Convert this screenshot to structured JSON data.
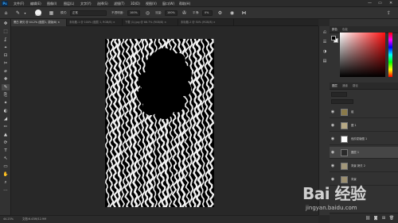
{
  "app": {
    "logo": "Ps"
  },
  "menu": [
    "文件(F)",
    "编辑(E)",
    "图像(I)",
    "图层(L)",
    "文字(Y)",
    "选择(S)",
    "滤镜(T)",
    "3D(D)",
    "视图(V)",
    "窗口(W)",
    "帮助(H)"
  ],
  "window_controls": {
    "minimize": "—",
    "restore": "▭",
    "close": "✕"
  },
  "options": {
    "brush_size": "1000",
    "mode_label": "模式:",
    "mode_value": "正常",
    "opacity_label": "不透明度:",
    "opacity_value": "100%",
    "flow_label": "流量:",
    "flow_value": "100%",
    "smooth_label": "平滑:",
    "smooth_value": "0%"
  },
  "tabs": [
    {
      "label": "黑白 拷贝 @ 44.2% (图层1, 蒙版/8) ×",
      "active": true
    },
    {
      "label": "未标题-1 @ 100% (图层 1, RGB/8) ×",
      "active": false
    },
    {
      "label": "下载 (1).jpg @ 66.7% (RGB/8) ×",
      "active": false
    },
    {
      "label": "未标题-2 @ 50% (RGB/8) ×",
      "active": false
    }
  ],
  "tools": [
    "✥",
    "⬚",
    "ʆ",
    "⌖",
    "⊡",
    "✂",
    "⌀",
    "✚",
    "✎",
    "⎘",
    "✦",
    "◐",
    "◢",
    "✏",
    "▲",
    "⟳",
    "T",
    "↖",
    "▭",
    "✋",
    "⌕",
    "⋯"
  ],
  "panels": {
    "color_tabs": [
      "颜色",
      "色板"
    ],
    "layer_tabs": [
      "图层",
      "通道",
      "路径"
    ]
  },
  "layers": [
    {
      "name": "组",
      "thumb": "#8a7a4a",
      "selected": false
    },
    {
      "name": "图 1",
      "thumb": "#b7a985",
      "selected": false
    },
    {
      "name": "色阶蒙版图 1",
      "thumb": "#ffffff",
      "selected": false
    },
    {
      "name": "图层 1",
      "thumb": "#2a2a2a",
      "selected": true
    },
    {
      "name": "背景 拷贝 2",
      "thumb": "#a2977a",
      "selected": false
    },
    {
      "name": "背景",
      "thumb": "#9c8f70",
      "selected": false
    }
  ],
  "status": {
    "zoom": "44.23%",
    "doc_info": "文档:6.43M/12.9M"
  },
  "watermark": {
    "logo": "Bai 经验",
    "url": "jingyan.baidu.com"
  }
}
